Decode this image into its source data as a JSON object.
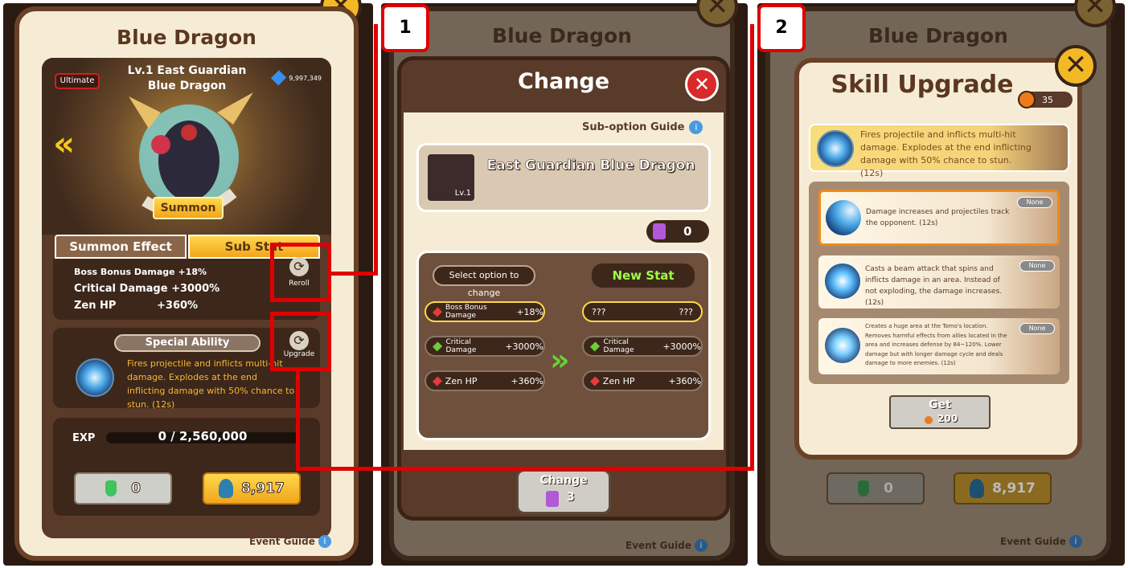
{
  "panel1": {
    "title": "Blue Dragon",
    "rank_badge": "Ultimate",
    "hero_name_line1": "Lv.1 East Guardian",
    "hero_name_line2": "Blue Dragon",
    "power": "9,997,349",
    "summon_label": "Summon",
    "tabs": [
      "Summon Effect",
      "Sub Stat"
    ],
    "stats": [
      {
        "name": "Boss Bonus Damage",
        "value": "+18%"
      },
      {
        "name": "Critical Damage",
        "value": "+3000%"
      },
      {
        "name": "Zen HP",
        "value": "+360%"
      }
    ],
    "reroll_label": "Reroll",
    "special_ability_label": "Special Ability",
    "upgrade_label": "Upgrade",
    "ability_text": "Fires projectile and inflicts multi-hit damage. Explodes at the end inflicting damage with 50% chance to stun. (12s)",
    "exp_label": "EXP",
    "exp_value": "0 / 2,560,000",
    "potion_count": "0",
    "currency_value": "8,917",
    "event_guide": "Event Guide"
  },
  "panel2": {
    "bg_title": "Blue Dragon",
    "title": "Change",
    "sub_option_guide": "Sub-option Guide",
    "hero_name": "East Guardian Blue Dragon",
    "hero_level": "Lv.1",
    "ticket_count": "0",
    "select_label": "Select option to change",
    "new_stat_label": "New Stat",
    "current_stats": [
      {
        "name": "Boss Bonus Damage",
        "value": "+18%",
        "color": "#e43b3b"
      },
      {
        "name": "Critical Damage",
        "value": "+3000%",
        "color": "#6ccf3a"
      },
      {
        "name": "Zen HP",
        "value": "+360%",
        "color": "#e43b3b"
      }
    ],
    "new_stats": [
      {
        "name": "???",
        "value": "???",
        "color": ""
      },
      {
        "name": "Critical Damage",
        "value": "+3000%",
        "color": "#6ccf3a"
      },
      {
        "name": "Zen HP",
        "value": "+360%",
        "color": "#e43b3b"
      }
    ],
    "change_btn_label": "Change",
    "change_btn_cost": "3",
    "event_guide": "Event Guide"
  },
  "panel3": {
    "bg_title": "Blue Dragon",
    "title": "Skill Upgrade",
    "currency": "35",
    "current_skill": "Fires projectile and inflicts multi-hit damage. Explodes at the end inflicting damage with 50% chance to stun. (12s)",
    "options": [
      {
        "text": "Damage increases and projectiles track the opponent. (12s)",
        "badge": "None"
      },
      {
        "text": "Casts a beam attack that spins and inflicts damage in an area. Instead of not exploding, the damage increases. (12s)",
        "badge": "None"
      },
      {
        "text": "Creates a huge area at the Tomo's location. Removes harmful effects from allies located in the area and increases defense by 84~120%. Lower damage but with longer damage cycle and deals damage to more enemies. (12s)",
        "badge": "None"
      }
    ],
    "get_label": "Get",
    "get_cost": "200",
    "potion_count": "0",
    "currency_value": "8,917",
    "event_guide": "Event Guide"
  },
  "callouts": [
    "1",
    "2"
  ],
  "colors": {
    "accent_red": "#e00000",
    "card_brown": "#6a4127",
    "gold": "#f3b925"
  }
}
